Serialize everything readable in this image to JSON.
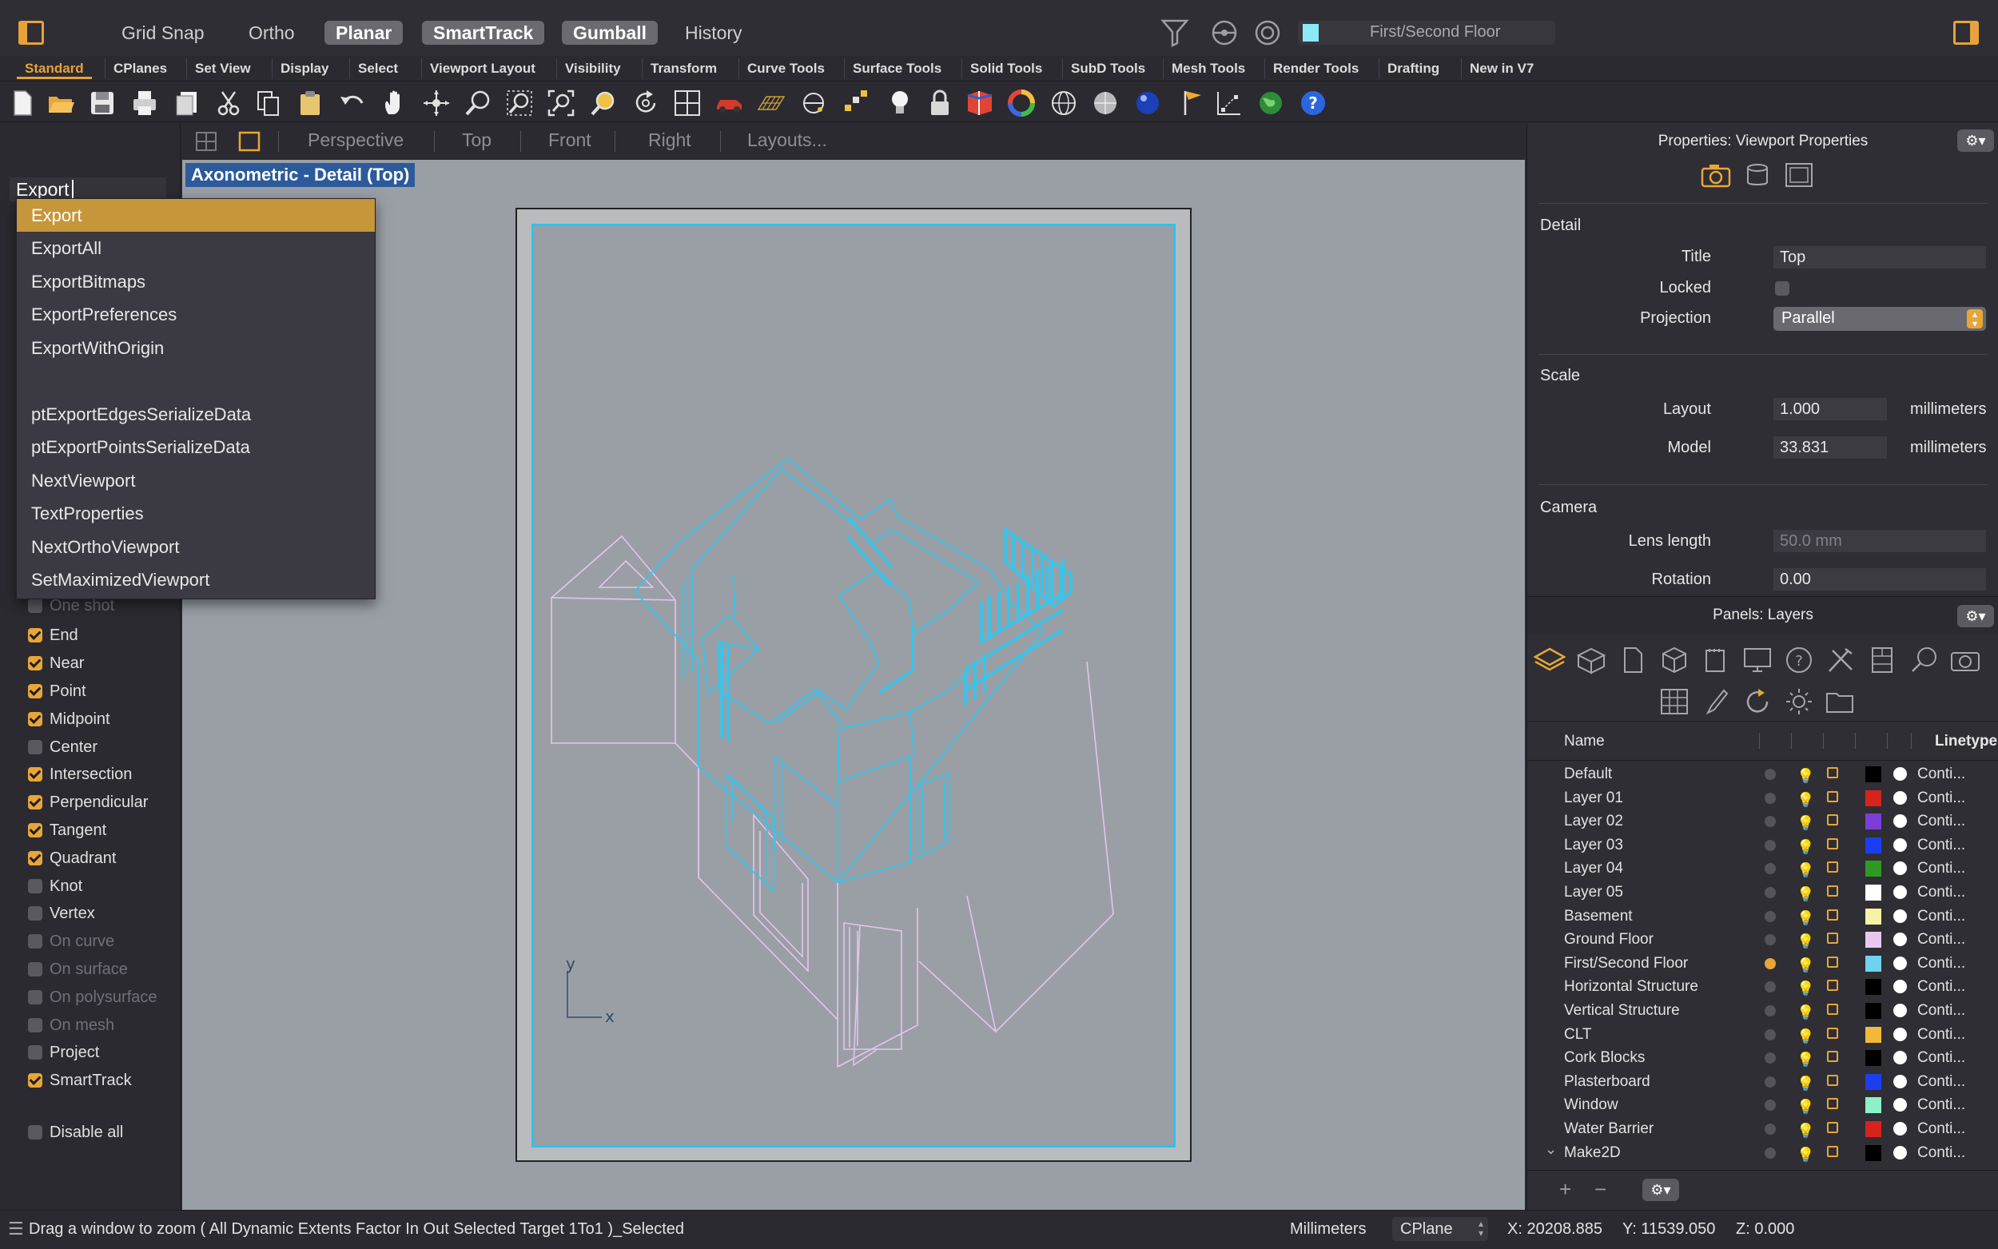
{
  "topbar": {
    "buttons": [
      {
        "label": "Grid Snap",
        "on": false
      },
      {
        "label": "Ortho",
        "on": false
      },
      {
        "label": "Planar",
        "on": true
      },
      {
        "label": "SmartTrack",
        "on": true
      },
      {
        "label": "Gumball",
        "on": true
      },
      {
        "label": "History",
        "on": false
      }
    ],
    "current_layer": "First/Second Floor",
    "current_layer_color": "#8be9f5"
  },
  "tabs": [
    "Standard",
    "CPlanes",
    "Set View",
    "Display",
    "Select",
    "Viewport Layout",
    "Visibility",
    "Transform",
    "Curve Tools",
    "Surface Tools",
    "Solid Tools",
    "SubD Tools",
    "Mesh Tools",
    "Render Tools",
    "Drafting",
    "New in V7"
  ],
  "active_tab": "Standard",
  "toolbar_icons": [
    "new-file-icon",
    "open-file-icon",
    "save-icon",
    "print-icon",
    "import-icon",
    "cut-icon",
    "copy-icon",
    "paste-icon",
    "undo-icon",
    "pan-hand-icon",
    "rotate-view-icon",
    "zoom-icon",
    "zoom-window-icon",
    "zoom-extents-icon",
    "zoom-selected-icon",
    "rotate-icon",
    "four-viewports-icon",
    "car-icon",
    "grid-icon",
    "point-icon",
    "select-points-icon",
    "bulb-icon",
    "lock-icon",
    "layer-icon",
    "color-wheel-icon",
    "sphere-wire-icon",
    "sphere-shaded-icon",
    "sphere-render-icon",
    "flag-icon",
    "dimension-icon",
    "globe-icon",
    "help-icon"
  ],
  "command": {
    "input": "Export",
    "suggestions": [
      "Export",
      "ExportAll",
      "ExportBitmaps",
      "ExportPreferences",
      "ExportWithOrigin",
      "",
      "ptExportEdgesSerializeData",
      "ptExportPointsSerializeData",
      "NextViewport",
      "TextProperties",
      "NextOrthoViewport",
      "SetMaximizedViewport"
    ],
    "selected": 0
  },
  "osnaps": [
    {
      "label": "One shot",
      "checked": false,
      "dim": true
    },
    {
      "label": "End",
      "checked": true,
      "dim": false
    },
    {
      "label": "Near",
      "checked": true,
      "dim": false
    },
    {
      "label": "Point",
      "checked": true,
      "dim": false
    },
    {
      "label": "Midpoint",
      "checked": true,
      "dim": false
    },
    {
      "label": "Center",
      "checked": false,
      "dim": false
    },
    {
      "label": "Intersection",
      "checked": true,
      "dim": false
    },
    {
      "label": "Perpendicular",
      "checked": true,
      "dim": false
    },
    {
      "label": "Tangent",
      "checked": true,
      "dim": false
    },
    {
      "label": "Quadrant",
      "checked": true,
      "dim": false
    },
    {
      "label": "Knot",
      "checked": false,
      "dim": false
    },
    {
      "label": "Vertex",
      "checked": false,
      "dim": false
    },
    {
      "label": "On curve",
      "checked": false,
      "dim": true
    },
    {
      "label": "On surface",
      "checked": false,
      "dim": true
    },
    {
      "label": "On polysurface",
      "checked": false,
      "dim": true
    },
    {
      "label": "On mesh",
      "checked": false,
      "dim": true
    },
    {
      "label": "Project",
      "checked": false,
      "dim": false
    },
    {
      "label": "SmartTrack",
      "checked": true,
      "dim": false
    }
  ],
  "disable_all": "Disable all",
  "viewport": {
    "tabs": [
      "Perspective",
      "Top",
      "Front",
      "Right",
      "Layouts..."
    ],
    "title": "Axonometric - Detail (Top)",
    "axis_x": "x",
    "axis_y": "y"
  },
  "properties": {
    "title": "Properties: Viewport Properties",
    "detail_section": "Detail",
    "title_label": "Title",
    "title_value": "Top",
    "locked_label": "Locked",
    "projection_label": "Projection",
    "projection_value": "Parallel",
    "scale_section": "Scale",
    "layout_label": "Layout",
    "layout_value": "1.000",
    "model_label": "Model",
    "model_value": "33.831",
    "unit": "millimeters",
    "camera_section": "Camera",
    "lens_label": "Lens length",
    "lens_value": "50.0 mm",
    "rotation_label": "Rotation",
    "rotation_value": "0.00"
  },
  "layers_panel": {
    "title": "Panels: Layers",
    "col_name": "Name",
    "col_linetype": "Linetype",
    "layers": [
      {
        "name": "Default",
        "color": "#000000",
        "current": false,
        "lt": "Conti..."
      },
      {
        "name": "Layer 01",
        "color": "#d8231c",
        "current": false,
        "lt": "Conti..."
      },
      {
        "name": "Layer 02",
        "color": "#7b3fd8",
        "current": false,
        "lt": "Conti..."
      },
      {
        "name": "Layer 03",
        "color": "#1a3ff0",
        "current": false,
        "lt": "Conti..."
      },
      {
        "name": "Layer 04",
        "color": "#2e9a24",
        "current": false,
        "lt": "Conti..."
      },
      {
        "name": "Layer 05",
        "color": "#ffffff",
        "current": false,
        "lt": "Conti..."
      },
      {
        "name": "Basement",
        "color": "#f5f3a8",
        "current": false,
        "lt": "Conti..."
      },
      {
        "name": "Ground Floor",
        "color": "#e9c8ef",
        "current": false,
        "lt": "Conti..."
      },
      {
        "name": "First/Second Floor",
        "color": "#6fd2ee",
        "current": true,
        "lt": "Conti..."
      },
      {
        "name": "Horizontal Structure",
        "color": "#000000",
        "current": false,
        "lt": "Conti..."
      },
      {
        "name": "Vertical Structure",
        "color": "#000000",
        "current": false,
        "lt": "Conti..."
      },
      {
        "name": "CLT",
        "color": "#f0b93a",
        "current": false,
        "lt": "Conti..."
      },
      {
        "name": "Cork Blocks",
        "color": "#000000",
        "current": false,
        "lt": "Conti..."
      },
      {
        "name": "Plasterboard",
        "color": "#1a3ff0",
        "current": false,
        "lt": "Conti..."
      },
      {
        "name": "Window",
        "color": "#8ef0c8",
        "current": false,
        "lt": "Conti..."
      },
      {
        "name": "Water Barrier",
        "color": "#d8231c",
        "current": false,
        "lt": "Conti..."
      },
      {
        "name": "Make2D",
        "color": "#000000",
        "current": false,
        "lt": "Conti..."
      }
    ]
  },
  "status": {
    "prompt": "Drag a window to zoom ( All Dynamic Extents Factor In Out Selected Target 1To1 )_Selected",
    "units": "Millimeters",
    "cplane": "CPlane",
    "x": "X: 20208.885",
    "y": "Y: 11539.050",
    "z": "Z: 0.000"
  }
}
